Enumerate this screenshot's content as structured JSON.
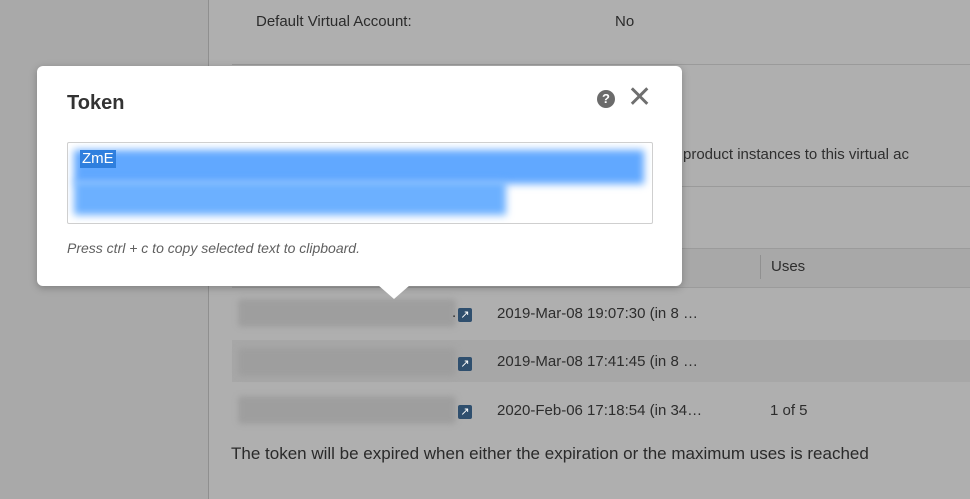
{
  "account": {
    "default_label": "Default Virtual Account:",
    "default_value": "No"
  },
  "description_partial": "w product instances to this virtual ac",
  "table": {
    "columns": [
      "Uses"
    ],
    "rows": [
      {
        "expires": "2019-Mar-08 19:07:30 (in 8 …",
        "uses": "",
        "trunc": "."
      },
      {
        "expires": "2019-Mar-08 17:41:45 (in 8 …",
        "uses": "",
        "trunc": ""
      },
      {
        "expires": "2020-Feb-06 17:18:54 (in 34…",
        "uses": "1 of 5",
        "trunc": ""
      }
    ]
  },
  "footer_note": "The token will be expired when either the expiration or the maximum uses is reached",
  "modal": {
    "title": "Token",
    "token_value": "ZmE",
    "hint": "Press ctrl + c to copy selected text to clipboard.",
    "help_icon": "question-circle-icon",
    "close_icon": "close-icon",
    "close_glyph": "✕"
  },
  "colors": {
    "selection": "#2f7fde",
    "backdrop": "#afafaf"
  }
}
